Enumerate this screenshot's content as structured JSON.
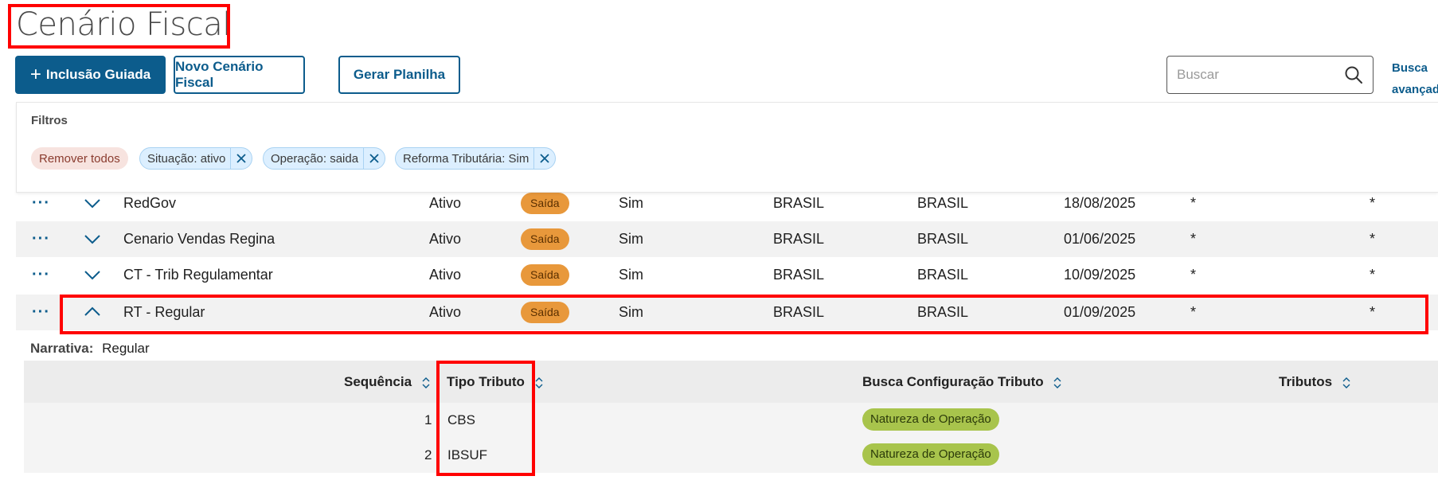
{
  "page": {
    "title": "Cenário Fiscal"
  },
  "toolbar": {
    "inclusao_label": "Inclusão Guiada",
    "novo_label": "Novo Cenário Fiscal",
    "gerar_label": "Gerar Planilha",
    "search_placeholder": "Buscar",
    "busca_avancada_line1": "Busca",
    "busca_avancada_line2": "avançada"
  },
  "filters": {
    "label": "Filtros",
    "remove_all": "Remover todos",
    "chips": [
      "Situação: ativo",
      "Operação: saida",
      "Reforma Tributária: Sim"
    ]
  },
  "rows": [
    {
      "name": "RedGov",
      "status": "Ativo",
      "operation": "Saída",
      "reform": "Sim",
      "origin": "BRASIL",
      "dest": "BRASIL",
      "date": "18/08/2025",
      "c1": "*",
      "c2": "*"
    },
    {
      "name": "Cenario Vendas Regina",
      "status": "Ativo",
      "operation": "Saída",
      "reform": "Sim",
      "origin": "BRASIL",
      "dest": "BRASIL",
      "date": "01/06/2025",
      "c1": "*",
      "c2": "*"
    },
    {
      "name": "CT - Trib Regulamentar",
      "status": "Ativo",
      "operation": "Saída",
      "reform": "Sim",
      "origin": "BRASIL",
      "dest": "BRASIL",
      "date": "10/09/2025",
      "c1": "*",
      "c2": "*"
    },
    {
      "name": "RT - Regular",
      "status": "Ativo",
      "operation": "Saída",
      "reform": "Sim",
      "origin": "BRASIL",
      "dest": "BRASIL",
      "date": "01/09/2025",
      "c1": "*",
      "c2": "*"
    }
  ],
  "row_actions_glyph": "···",
  "detail": {
    "narrativa_label": "Narrativa:",
    "narrativa_value": "Regular",
    "headers": {
      "sequencia": "Sequência",
      "tipo": "Tipo Tributo",
      "busca": "Busca Configuração Tributo",
      "tributos": "Tributos"
    },
    "rows": [
      {
        "seq": "1",
        "tipo": "CBS",
        "busca": "Natureza de Operação"
      },
      {
        "seq": "2",
        "tipo": "IBSUF",
        "busca": "Natureza de Operação"
      }
    ]
  },
  "colors": {
    "primary": "#0c5c8c",
    "badge_orange": "#e8983b",
    "badge_green": "#a8c44c",
    "highlight": "#ff0000"
  }
}
